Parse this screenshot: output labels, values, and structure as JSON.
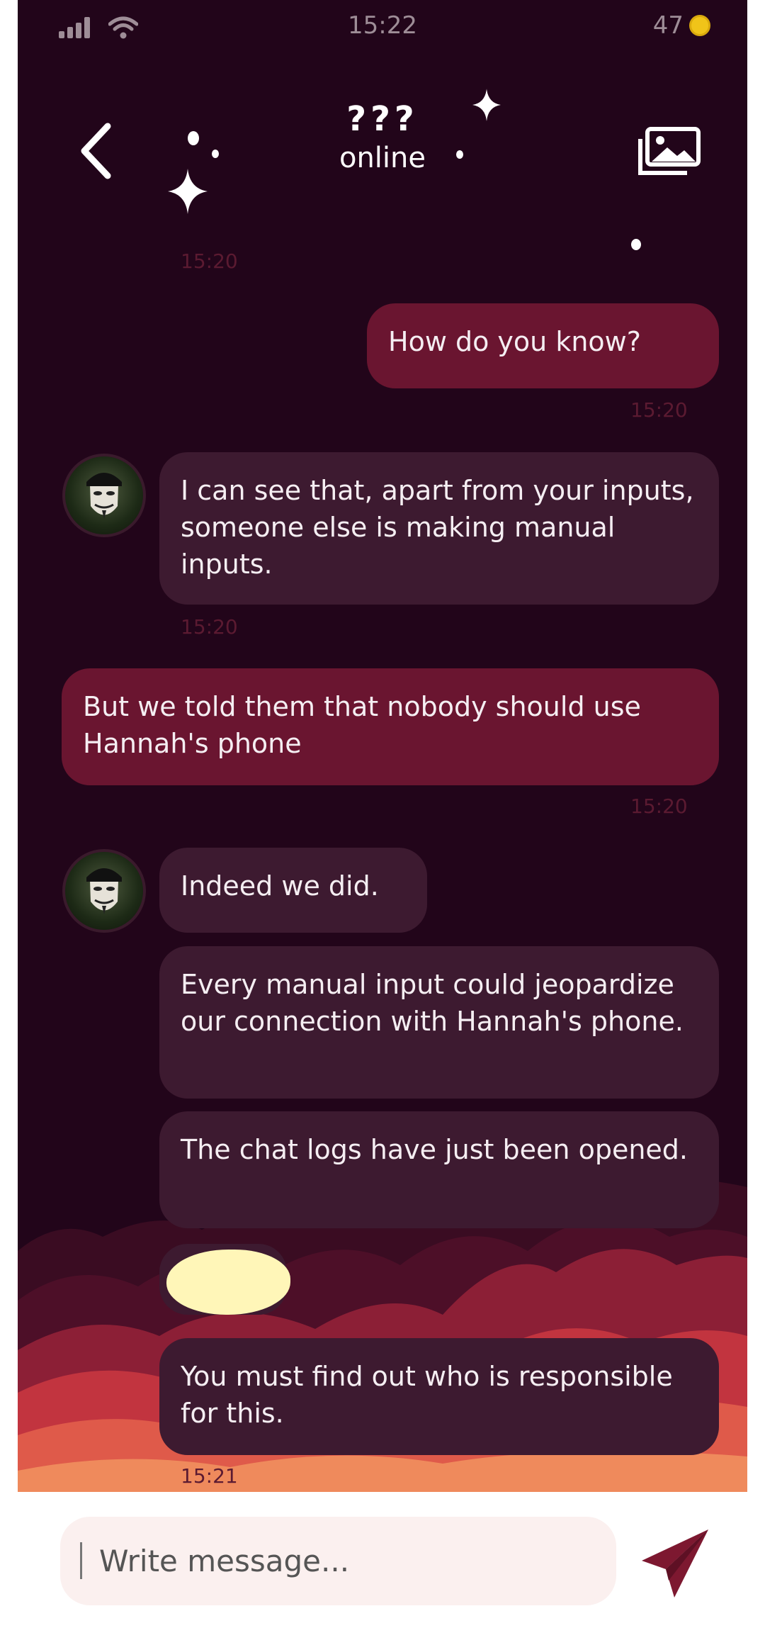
{
  "status_bar": {
    "time": "15:22",
    "battery": "47"
  },
  "header": {
    "title": "???",
    "subtitle": "online"
  },
  "colors": {
    "background": "#22051a",
    "incoming_bubble": "#3d1a30",
    "outgoing_bubble": "#6a1530",
    "timestamp": "#5b1a31",
    "send_icon": "#7d1830"
  },
  "messages": [
    {
      "time": "15:20"
    },
    {
      "text": "How do you know?",
      "direction": "outgoing",
      "time": "15:20"
    },
    {
      "text": "I can see that, apart from your inputs, someone else is making manual inputs.",
      "direction": "incoming",
      "time": "15:20"
    },
    {
      "text": "But we told them that nobody should use Hannah's phone",
      "direction": "outgoing",
      "time": "15:20"
    },
    {
      "text": "Indeed we did.",
      "direction": "incoming"
    },
    {
      "text": "Every manual input could jeopardize our connection with Hannah's phone.",
      "direction": "incoming"
    },
    {
      "text": "The chat logs have just been opened.",
      "direction": "incoming"
    },
    {
      "text": "You must find out who is responsible for this.",
      "direction": "incoming",
      "time": "15:21"
    }
  ],
  "composer": {
    "placeholder": "Write message..."
  },
  "icons": [
    "signal-icon",
    "wifi-icon",
    "coin-icon",
    "back-icon",
    "gallery-icon",
    "send-icon",
    "sparkle-icon"
  ]
}
